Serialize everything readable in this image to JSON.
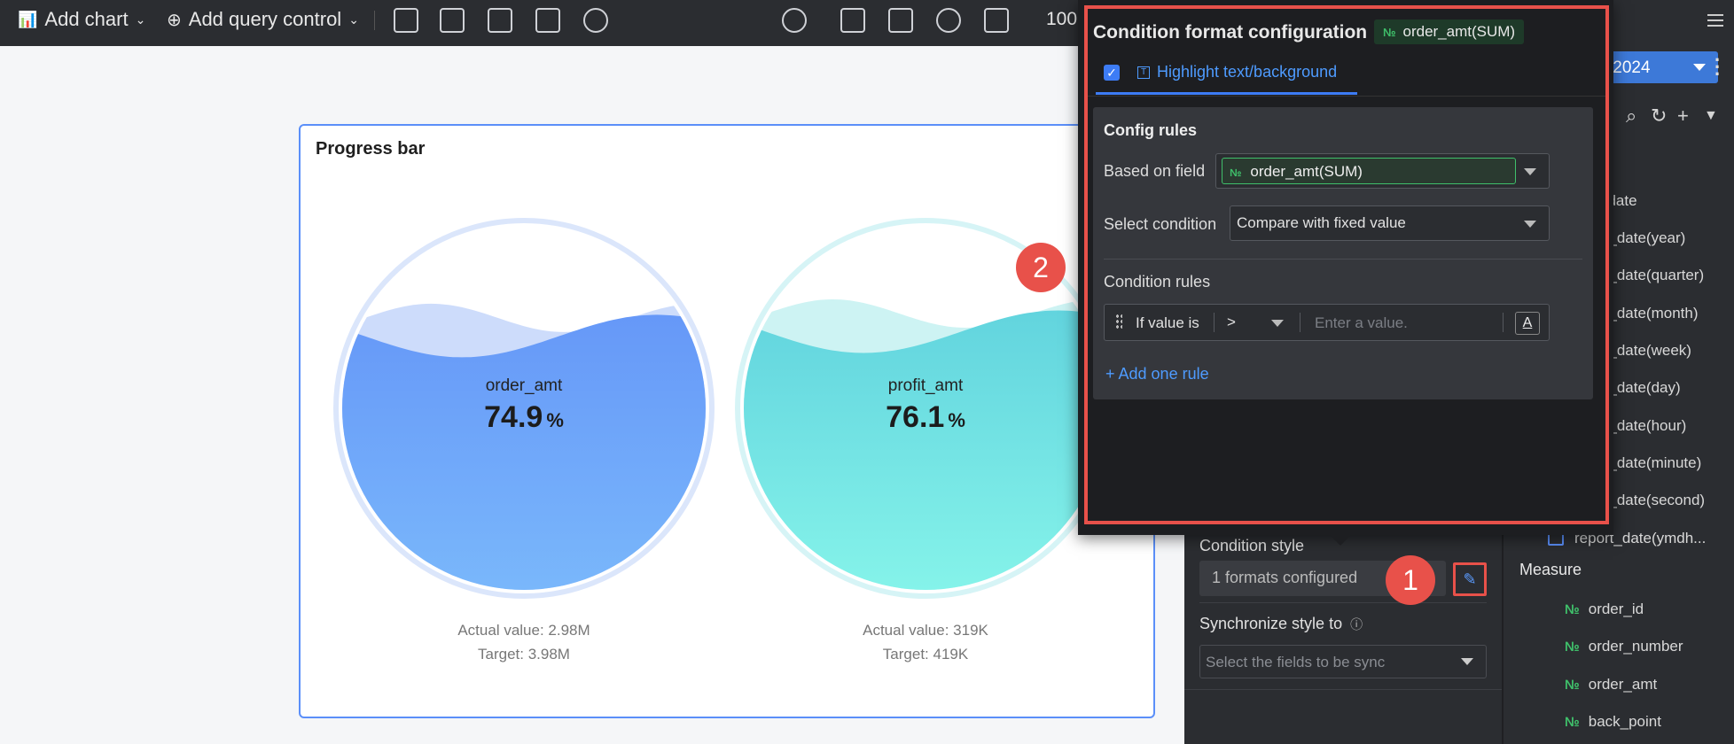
{
  "toolbar": {
    "add_chart": "Add chart",
    "add_query_control": "Add query control",
    "zoom": "100"
  },
  "card": {
    "title": "Progress bar",
    "gauges": [
      {
        "label": "order_amt",
        "percent": "74.9",
        "percent_symbol": "%",
        "actual": "Actual value: 2.98M",
        "target": "Target: 3.98M",
        "fill_fraction": 0.749,
        "color": "#5b8ff9"
      },
      {
        "label": "profit_amt",
        "percent": "76.1",
        "percent_symbol": "%",
        "actual": "Actual value: 319K",
        "target": "Target: 419K",
        "fill_fraction": 0.761,
        "color": "#5ad8e6"
      }
    ]
  },
  "style_panel": {
    "condition_style_label": "Condition style",
    "formats_configured": "1 formats configured",
    "sync_label": "Synchronize style to",
    "sync_placeholder": "Select the fields to be sync"
  },
  "fields_panel": {
    "date_value": ".2024",
    "dimension_items": [
      "_date",
      "rt_date(year)",
      "rt_date(quarter)",
      "rt_date(month)",
      "rt_date(week)",
      "rt_date(day)",
      "rt_date(hour)",
      "rt_date(minute)",
      "rt_date(second)",
      "report_date(ymdh..."
    ],
    "measure_header": "Measure",
    "measures": [
      "order_id",
      "order_number",
      "order_amt",
      "back_point"
    ],
    "num_icon": "№"
  },
  "popup": {
    "title": "Condition format configuration",
    "field_tag": "order_amt(SUM)",
    "tab_label": "Highlight text/background",
    "config_rules_title": "Config rules",
    "based_on_field_label": "Based on field",
    "based_on_field_value": "order_amt(SUM)",
    "select_condition_label": "Select condition",
    "select_condition_value": "Compare with fixed value",
    "condition_rules_label": "Condition rules",
    "rule": {
      "prefix": "If value is",
      "operator": ">",
      "value_placeholder": "Enter a value.",
      "style_button": "A"
    },
    "add_rule": "+ Add one rule"
  },
  "callouts": {
    "one": "1",
    "two": "2"
  },
  "colors": {
    "accent": "#3d7cf5",
    "highlight_red": "#e8514a",
    "measure_green": "#3fbf6a"
  }
}
